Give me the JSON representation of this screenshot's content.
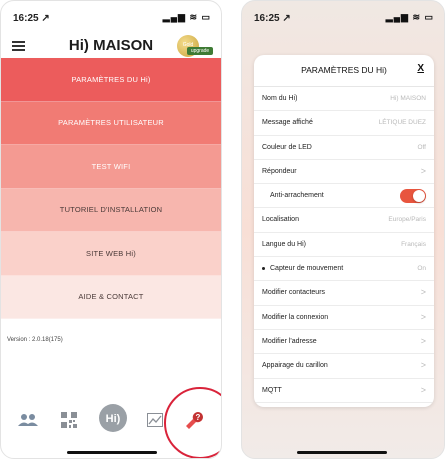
{
  "left": {
    "status": {
      "time": "16:25 ↗",
      "icons": "▂▄▆ ≋ ▭"
    },
    "header": {
      "title": "Hi) MAISON",
      "badge_text": "Gold",
      "badge_tag": "upgrade"
    },
    "menu": [
      "PARAMÈTRES DU Hi)",
      "PARAMÈTRES UTILISATEUR",
      "TEST WIFI",
      "TUTORIEL D'INSTALLATION",
      "SITE WEB Hi)",
      "AIDE & CONTACT"
    ],
    "version": "Version : 2.0.18(175)",
    "tabs": [
      "users-icon",
      "qr-code-icon",
      "hi-logo-icon",
      "chart-icon",
      "settings-alert-icon"
    ]
  },
  "right": {
    "status": {
      "time": "16:25 ↗",
      "icons": "▂▄▆ ≋ ▭"
    },
    "modal": {
      "title": "PARAMÈTRES DU Hi)",
      "close": "X",
      "rows": [
        {
          "label": "Nom du Hi)",
          "value": "Hi) MAISON"
        },
        {
          "label": "Message affiché",
          "value": "LÉTIQUE DUEZ"
        },
        {
          "label": "Couleur de LED",
          "value": "Off"
        },
        {
          "label": "Répondeur",
          "value": ">"
        },
        {
          "label": "Anti-arrachement",
          "toggle": true
        },
        {
          "label": "Localisation",
          "value": "Europe/Paris"
        },
        {
          "label": "Langue du Hi)",
          "value": "Français"
        },
        {
          "label": "Capteur de mouvement",
          "value": "On"
        },
        {
          "label": "Modifier contacteurs",
          "value": ">"
        },
        {
          "label": "Modifier la connexion",
          "value": ">"
        },
        {
          "label": "Modifier l'adresse",
          "value": ">"
        },
        {
          "label": "Appairage du carillon",
          "value": ">"
        },
        {
          "label": "MQTT",
          "value": ">"
        }
      ]
    }
  },
  "colors": {
    "accent": "#ec5c5c",
    "toggle_on": "#e8553e",
    "highlight_circle": "#d9233a"
  }
}
